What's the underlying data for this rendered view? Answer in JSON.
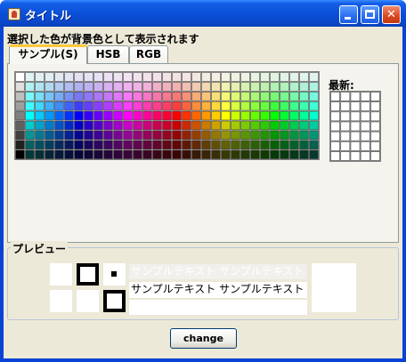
{
  "window": {
    "title": "タイトル"
  },
  "hint": "選択した色が背景色として表示されます",
  "tabs": [
    {
      "label": "サンプル(S)",
      "active": true
    },
    {
      "label": "HSB",
      "active": false
    },
    {
      "label": "RGB",
      "active": false
    }
  ],
  "swatches": {
    "columns": 31,
    "rows": 9
  },
  "recent": {
    "label": "最新:",
    "columns": 5,
    "rows": 7
  },
  "preview": {
    "label": "プレビュー",
    "sample_text_top": "サンプルテキスト サンプルテキスト",
    "sample_text_bottom": "サンプルテキスト サンプルテキスト"
  },
  "change_button": {
    "label": "change"
  }
}
